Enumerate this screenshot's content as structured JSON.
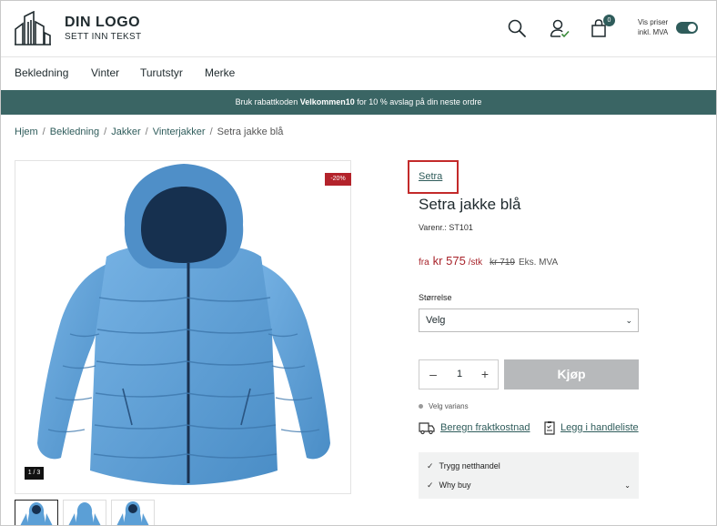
{
  "header": {
    "logo_title": "DIN LOGO",
    "logo_subtitle": "SETT INN TEKST",
    "cart_count": "0",
    "price_toggle_line1": "Vis priser",
    "price_toggle_line2": "inkl. MVA"
  },
  "nav": {
    "items": [
      "Bekledning",
      "Vinter",
      "Turutstyr",
      "Merke"
    ]
  },
  "promo": {
    "before": "Bruk rabattkoden ",
    "code": "Velkommen10",
    "after": " for 10 % avslag på din neste ordre"
  },
  "breadcrumb": {
    "items": [
      "Hjem",
      "Bekledning",
      "Jakker",
      "Vinterjakker"
    ],
    "current": "Setra jakke blå"
  },
  "gallery": {
    "discount_badge": "-20%",
    "counter": "1 / 3",
    "thumbnail_count": 3
  },
  "product": {
    "brand": "Setra",
    "title": "Setra jakke blå",
    "sku": "Varenr.: ST101",
    "price_prefix": "fra",
    "price": "kr 575",
    "price_unit": "/stk",
    "old_price": "kr 719",
    "vat_note": "Eks. MVA",
    "size_label": "Størrelse",
    "size_value": "Velg",
    "quantity": "1",
    "buy_label": "Kjøp",
    "variant_note": "Velg varians",
    "shipping_link": "Beregn fraktkostnad",
    "wishlist_link": "Legg i handleliste",
    "benefits": [
      "Trygg netthandel",
      "Why buy"
    ]
  },
  "colors": {
    "accent": "#2f5c5b",
    "sale_red": "#a8242b",
    "jacket_blue": "#5b9fd6"
  }
}
